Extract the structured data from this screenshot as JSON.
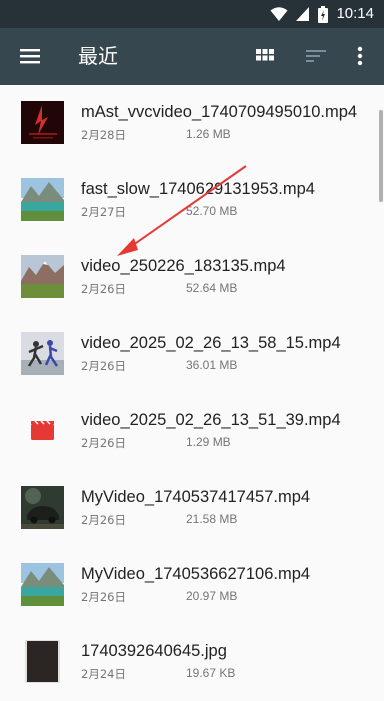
{
  "status": {
    "time": "10:14"
  },
  "toolbar": {
    "title": "最近",
    "menu_icon": "menu-icon",
    "grid_icon": "grid-view-icon",
    "sort_icon": "sort-icon",
    "more_icon": "more-vert-icon"
  },
  "colors": {
    "status_bar": "#263238",
    "toolbar": "#37474f",
    "background": "#fafafa",
    "arrow": "#e53935"
  },
  "files": [
    {
      "name": "mAst_vvcvideo_1740709495010.mp4",
      "date": "2月28日",
      "size": "1.26 MB",
      "thumb": "red-dark-thumbnail"
    },
    {
      "name": "fast_slow_1740629131953.mp4",
      "date": "2月27日",
      "size": "52.70 MB",
      "thumb": "lake-mountain-thumbnail"
    },
    {
      "name": "video_250226_183135.mp4",
      "date": "2月26日",
      "size": "52.64 MB",
      "thumb": "mountain-valley-thumbnail"
    },
    {
      "name": "video_2025_02_26_13_58_15.mp4",
      "date": "2月26日",
      "size": "36.01 MB",
      "thumb": "dancers-thumbnail"
    },
    {
      "name": "video_2025_02_26_13_51_39.mp4",
      "date": "2月26日",
      "size": "1.29 MB",
      "thumb": "video-clapper-icon"
    },
    {
      "name": "MyVideo_1740537417457.mp4",
      "date": "2月26日",
      "size": "21.58 MB",
      "thumb": "car-dark-thumbnail"
    },
    {
      "name": "MyVideo_1740536627106.mp4",
      "date": "2月26日",
      "size": "20.97 MB",
      "thumb": "lake-mountain-thumbnail"
    },
    {
      "name": "1740392640645.jpg",
      "date": "2月24日",
      "size": "19.67 KB",
      "thumb": "dark-photo-thumbnail"
    }
  ]
}
